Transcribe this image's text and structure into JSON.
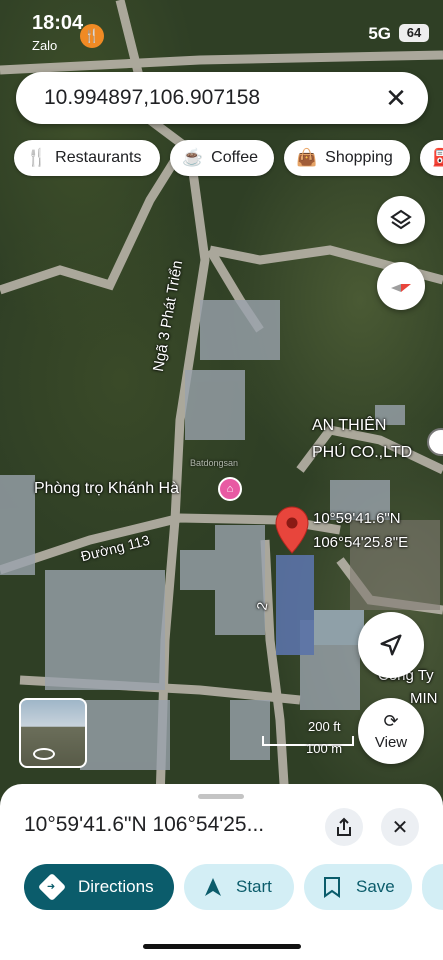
{
  "status_bar": {
    "time": "18:04",
    "app": "Zalo",
    "network": "5G",
    "battery": "64"
  },
  "search": {
    "query": "10.994897,106.907158",
    "close_icon": "close-icon"
  },
  "chips": [
    {
      "label": "Restaurants",
      "icon": "fork-knife-icon"
    },
    {
      "label": "Coffee",
      "icon": "coffee-cup-icon"
    },
    {
      "label": "Shopping",
      "icon": "shopping-bag-icon"
    }
  ],
  "map": {
    "labels": {
      "road_vertical": "Ngã 3 Phát Triển",
      "road_113": "Đường 113",
      "road_2": "2",
      "place_an_thien_1": "AN THIÊN",
      "place_an_thien_2": "PHÚ CO.,LTD",
      "place_phong_tro": "Phòng trọ Khánh Hà",
      "pin_lat": "10°59'41.6\"N",
      "pin_lng": "106°54'25.8\"E",
      "cong_ty_1": "Công Ty",
      "cong_ty_2": "MIN",
      "watermark": "Batdongsan"
    },
    "scale": {
      "imperial": "200 ft",
      "metric": "100 m"
    },
    "view_button": "View",
    "pin_color": "#e8453c",
    "hotel_color": "#e85aa3"
  },
  "sheet": {
    "title": "10°59'41.6\"N 106°54'25...",
    "actions": [
      {
        "label": "Directions",
        "icon": "directions-icon"
      },
      {
        "label": "Start",
        "icon": "navigation-arrow-icon"
      },
      {
        "label": "Save",
        "icon": "bookmark-icon"
      }
    ]
  },
  "colors": {
    "accent": "#0b5c6b",
    "accent_light": "#d3eef5"
  }
}
